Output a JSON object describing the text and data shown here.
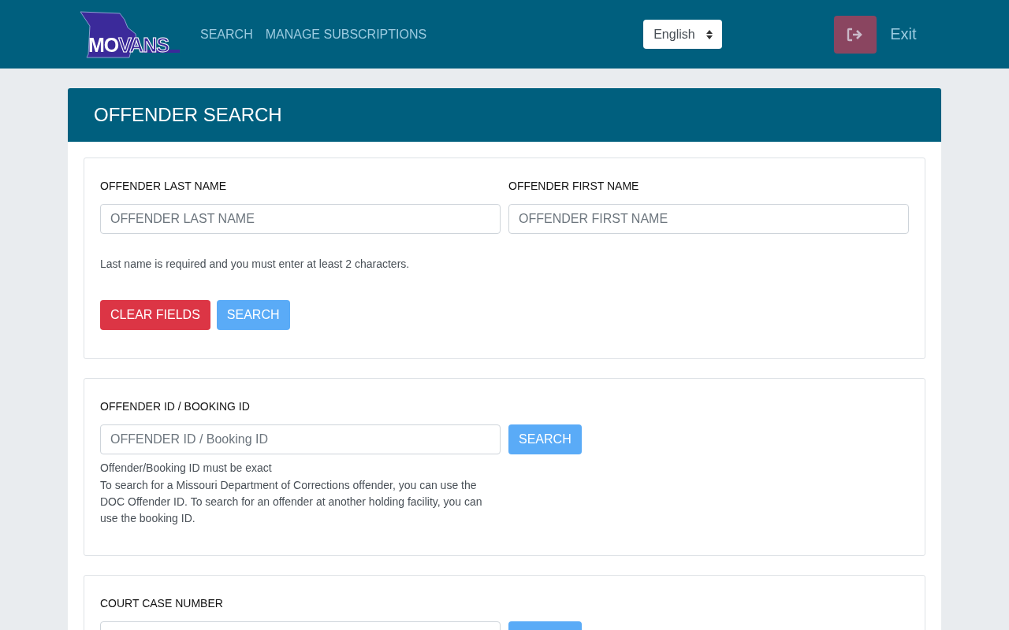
{
  "logo": {
    "part_1": "MO",
    "part_2": "VANS"
  },
  "nav": [
    {
      "label": "SEARCH"
    },
    {
      "label": "MANAGE SUBSCRIPTIONS"
    }
  ],
  "language": {
    "value": "English"
  },
  "exit": {
    "label": "Exit"
  },
  "panel": {
    "title": "OFFENDER SEARCH"
  },
  "name_section": {
    "fields": [
      {
        "label": "OFFENDER LAST NAME",
        "placeholder": "OFFENDER LAST NAME"
      },
      {
        "label": "OFFENDER FIRST NAME",
        "placeholder": "OFFENDER FIRST NAME"
      }
    ],
    "hint": "Last name is required and you must enter at least 2 characters.",
    "buttons": [
      {
        "label": "CLEAR FIELDS",
        "kind": "danger"
      },
      {
        "label": "SEARCH",
        "kind": "primary"
      }
    ]
  },
  "id_section": {
    "label": "OFFENDER ID / BOOKING ID",
    "placeholder": "OFFENDER ID / Booking ID",
    "button": "SEARCH",
    "note": "Offender/Booking ID must be exact",
    "help": "To search for a Missouri Department of Corrections offender, you can use the DOC Offender ID. To search for an offender at another holding facility, you can use the booking ID."
  },
  "case_section": {
    "label": "COURT CASE NUMBER"
  }
}
